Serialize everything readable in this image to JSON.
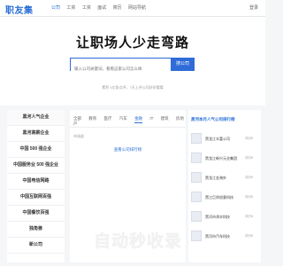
{
  "nav": {
    "logo": "职友集",
    "links": [
      "公司",
      "工资",
      "工资",
      "面试",
      "简历",
      "网站导航"
    ],
    "login": "登录"
  },
  "hero": {
    "title": "让职场人少走弯路",
    "search_placeholder": "输入公司关键词，看看这家公司怎么样",
    "search_button": "搜公司",
    "note": "累积 1亿条点评，7天上评公司好好看看"
  },
  "left_menu": [
    "黑河人气企业",
    "黑河高薪企业",
    "中国 500 强企业",
    "中国服务业 500 强企业",
    "中国电信网路",
    "中国互联网百强",
    "中国餐饮百强",
    "独角兽",
    "新公司"
  ],
  "mid": {
    "tabs": [
      "全部",
      "教育",
      "医疗",
      "汽车",
      "金融",
      "IT",
      "建筑",
      "房地产"
    ],
    "active_tab_index": 4,
    "small_text": "市场部",
    "link": "查看公司排行榜"
  },
  "right": {
    "title": "黑河本月人气公司排行榜",
    "items": [
      {
        "name": "黑龙江丰富公司",
        "badge": "评分5"
      },
      {
        "name": "黑龙江新兴元业集团",
        "badge": "评分5"
      },
      {
        "name": "黑龙江金海外",
        "badge": "评分5"
      },
      {
        "name": "黑江巨岸创意科技",
        "badge": "评分5"
      },
      {
        "name": "黑河市鸿丰科技",
        "badge": "评分5"
      },
      {
        "name": "黑河市汽车科技",
        "badge": "评分5"
      }
    ]
  },
  "watermark": "自动秒收录"
}
